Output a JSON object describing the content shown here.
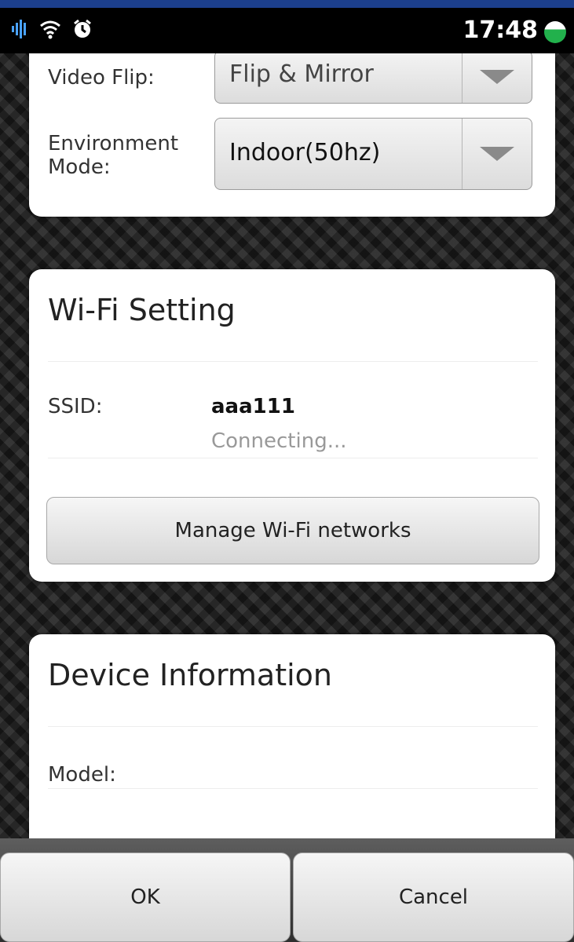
{
  "status_bar": {
    "time": "17:48",
    "icons": [
      "signal-icon",
      "wifi-icon",
      "alarm-icon",
      "battery-icon"
    ]
  },
  "camera_settings": {
    "video_flip_label": "Video Flip:",
    "video_flip_value": "Flip & Mirror",
    "environment_mode_label": "Environment Mode:",
    "environment_mode_value": "Indoor(50hz)"
  },
  "wifi": {
    "title": "Wi-Fi Setting",
    "ssid_label": "SSID:",
    "ssid_value": "aaa111",
    "status": "Connecting...",
    "manage_button": "Manage Wi-Fi networks"
  },
  "device": {
    "title": "Device Information",
    "model_label": "Model:"
  },
  "footer": {
    "ok_label": "OK",
    "cancel_label": "Cancel"
  },
  "colors": {
    "accent_top": "#1c3f8c",
    "battery": "#22b14c"
  }
}
